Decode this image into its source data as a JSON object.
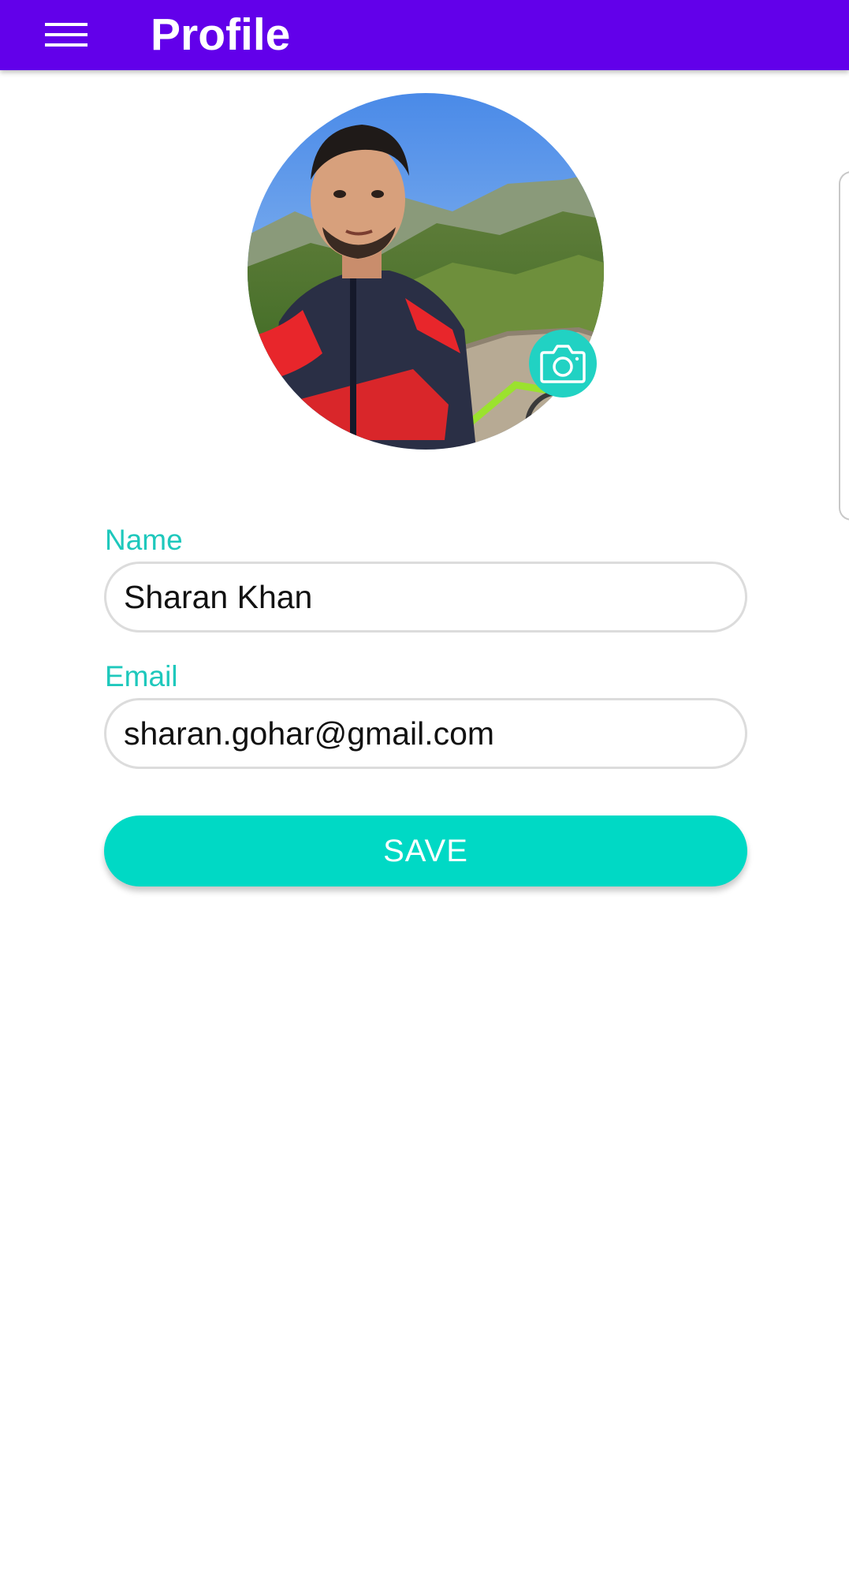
{
  "app_bar": {
    "title": "Profile",
    "menu_icon": "hamburger-menu-icon",
    "color": "#6200ea"
  },
  "profile": {
    "avatar": "profile-photo",
    "camera_icon": "camera-icon",
    "accent_color": "#00d9c5"
  },
  "form": {
    "name_label": "Name",
    "name_value": "Sharan Khan",
    "email_label": "Email",
    "email_value": "sharan.gohar@gmail.com"
  },
  "actions": {
    "save_label": "SAVE"
  }
}
